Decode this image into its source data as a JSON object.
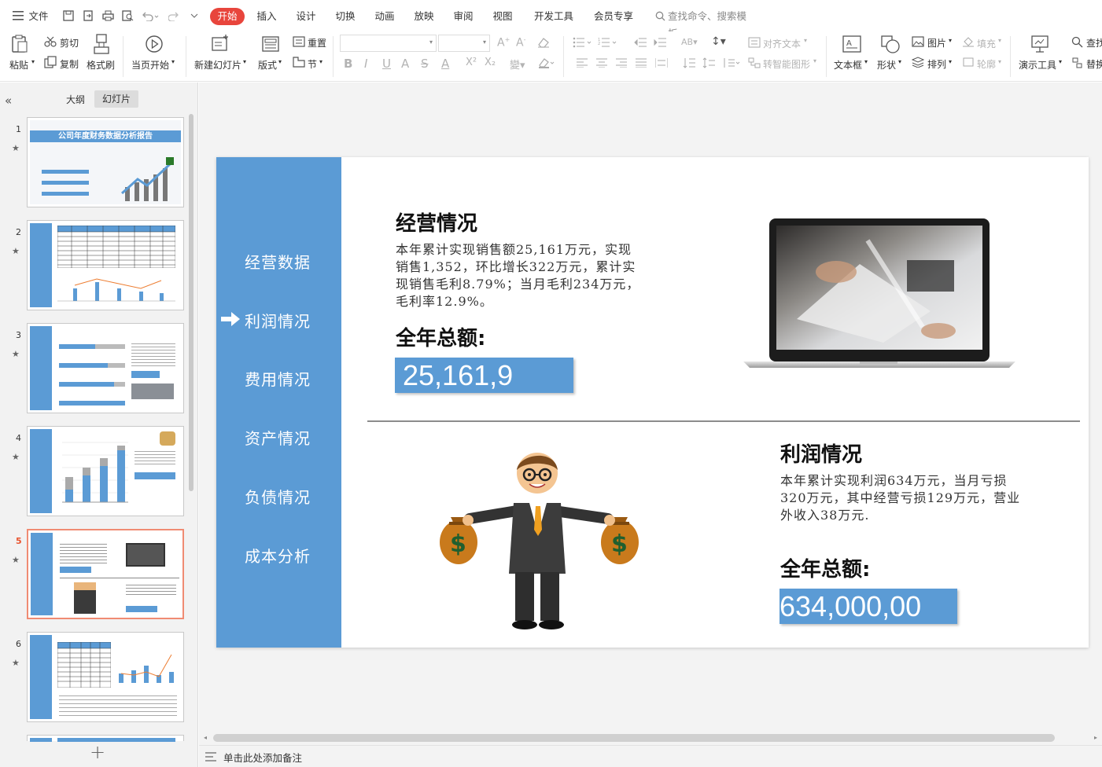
{
  "menubar": {
    "file_label": "文件",
    "tabs": [
      "开始",
      "插入",
      "设计",
      "切换",
      "动画",
      "放映",
      "审阅",
      "视图",
      "开发工具",
      "会员专享"
    ],
    "active_tab": "开始",
    "search_placeholder": "查找命令、搜索模板"
  },
  "ribbon": {
    "paste": "粘贴",
    "cut": "剪切",
    "copy": "复制",
    "format_painter": "格式刷",
    "from_current": "当页开始",
    "new_slide": "新建幻灯片",
    "layout": "版式",
    "reset": "重置",
    "section": "节",
    "align_text": "对齐文本",
    "smartart": "转智能图形",
    "textbox": "文本框",
    "shape": "形状",
    "picture": "图片",
    "fill": "填充",
    "arrange": "排列",
    "outline": "轮廓",
    "present_tool": "演示工具",
    "find": "查找",
    "replace": "替换",
    "font_buttons": [
      "B",
      "I",
      "U",
      "A",
      "S",
      "A",
      "X²",
      "X₂"
    ]
  },
  "leftpanel": {
    "tab_outline": "大纲",
    "tab_slides": "幻灯片",
    "slide_numbers": [
      "1",
      "2",
      "3",
      "4",
      "5",
      "6"
    ],
    "selected_slide": "5",
    "thumb1_title": "公司年度财务数据分析报告",
    "add_label": "+"
  },
  "slide": {
    "nav": [
      "经营数据",
      "利润情况",
      "费用情况",
      "资产情况",
      "负债情况",
      "成本分析"
    ],
    "nav_active_index": 1,
    "section1": {
      "heading": "经营情况",
      "text_lines": [
        "本年累计实现销售额25,161万元，实现",
        "销售1,352，环比增长322万元，累计实",
        "现销售毛利8.79%；当月毛利234万元，",
        "毛利率12.9%。"
      ],
      "total_label": "全年总额:",
      "total_value": "25,161,9"
    },
    "section2": {
      "heading": "利润情况",
      "text_lines": [
        "本年累计实现利润634万元，当月亏损",
        "320万元，其中经营亏损129万元，营业",
        "外收入38万元."
      ],
      "total_label": "全年总额:",
      "total_value": "634,000,00"
    },
    "money_symbol": "$"
  },
  "statusbar": {
    "notes_label": "单击此处添加备注"
  },
  "colors": {
    "accent": "#5b9bd5",
    "tab_active": "#e8453c",
    "selected_border": "#f08b73"
  }
}
